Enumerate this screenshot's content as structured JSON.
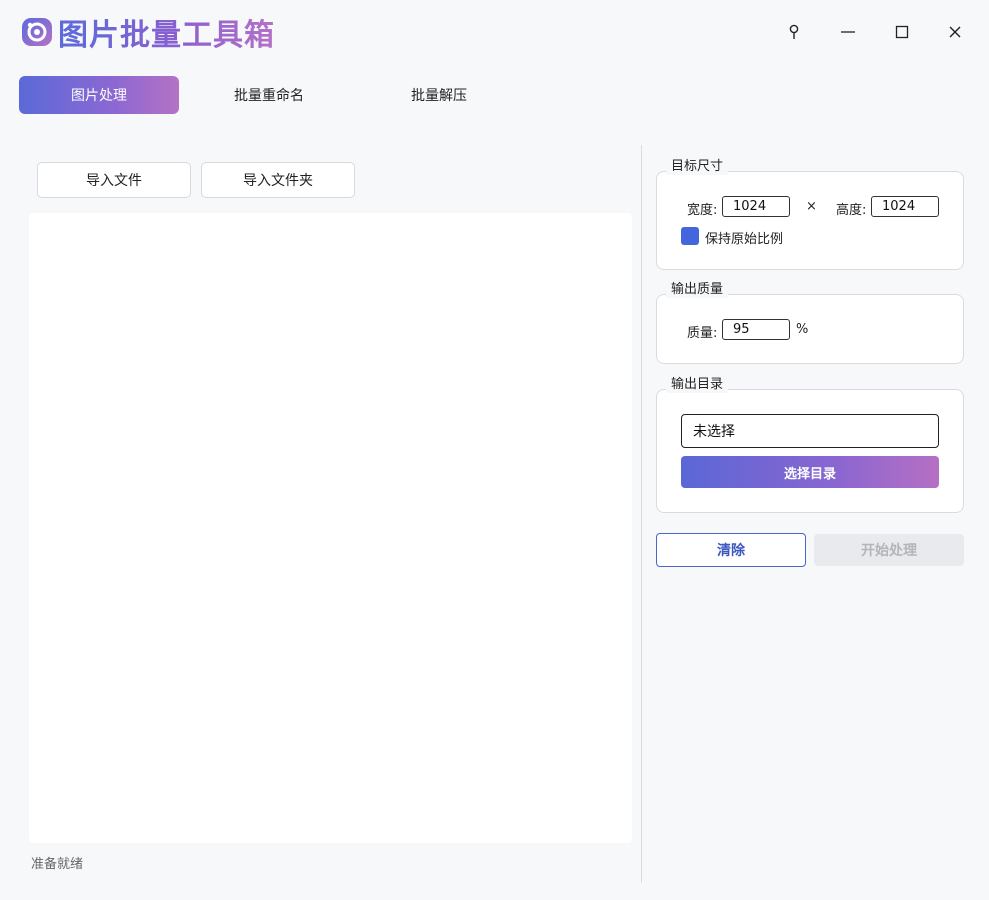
{
  "app": {
    "title": "图片批量工具箱",
    "logo_icon": "image-flower-icon"
  },
  "window_controls": {
    "pin_icon": "pin-icon",
    "minimize_icon": "minimize-icon",
    "maximize_icon": "maximize-icon",
    "close_icon": "close-icon"
  },
  "tabs": [
    {
      "label": "图片处理",
      "active": true
    },
    {
      "label": "批量重命名",
      "active": false
    },
    {
      "label": "批量解压",
      "active": false
    }
  ],
  "left_panel": {
    "import_files_label": "导入文件",
    "import_folder_label": "导入文件夹",
    "status_text": "准备就绪"
  },
  "target_size": {
    "title": "目标尺寸",
    "width_label": "宽度:",
    "width_value": "1024",
    "times_sign": "×",
    "height_label": "高度:",
    "height_value": "1024",
    "keep_ratio_label": "保持原始比例",
    "keep_ratio_checked": true
  },
  "output_quality": {
    "title": "输出质量",
    "quality_label": "质量:",
    "quality_value": "95",
    "percent_sign": "%"
  },
  "output_dir": {
    "title": "输出目录",
    "dir_value": "未选择",
    "choose_button_label": "选择目录"
  },
  "actions": {
    "clear_label": "清除",
    "start_label": "开始处理",
    "start_disabled": true
  },
  "colors": {
    "accent_start": "#5a6ad8",
    "accent_end": "#b472c5",
    "checkbox": "#4466dd",
    "clear_border": "#4a64c8",
    "background": "#f7f8fa"
  }
}
